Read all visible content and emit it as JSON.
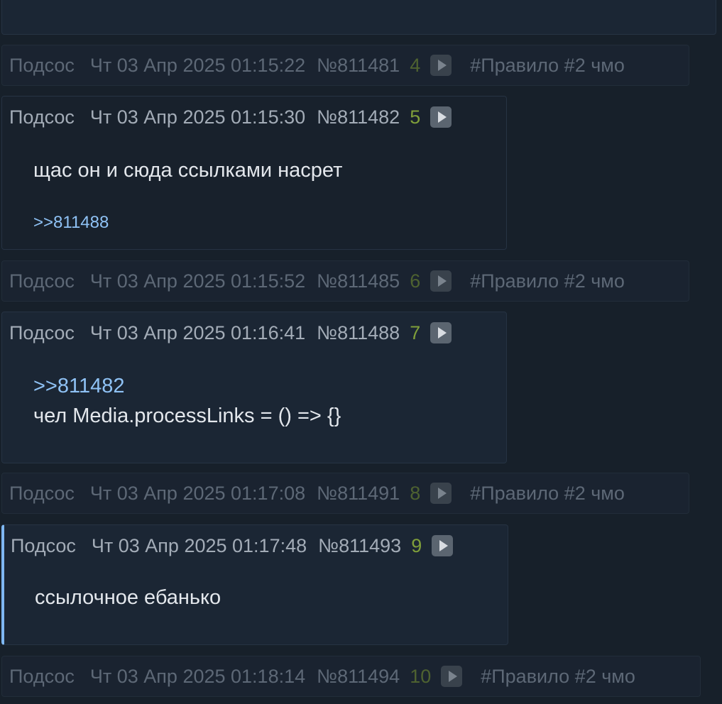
{
  "posts": [
    {
      "name": "Подсос",
      "date": "Чт 03 Апр 2025 01:15:22",
      "num": "№811481",
      "count": "4",
      "tag": "#Правило #2 чмо"
    },
    {
      "name": "Подсос",
      "date": "Чт 03 Апр 2025 01:15:30",
      "num": "№811482",
      "count": "5",
      "text": "щас он и сюда ссылками насрет",
      "reply": ">>811488"
    },
    {
      "name": "Подсос",
      "date": "Чт 03 Апр 2025 01:15:52",
      "num": "№811485",
      "count": "6",
      "tag": "#Правило #2 чмо"
    },
    {
      "name": "Подсос",
      "date": "Чт 03 Апр 2025 01:16:41",
      "num": "№811488",
      "count": "7",
      "quote": ">>811482",
      "text": "чел Media.processLinks = () => {}"
    },
    {
      "name": "Подсос",
      "date": "Чт 03 Апр 2025 01:17:08",
      "num": "№811491",
      "count": "8",
      "tag": "#Правило #2 чмо"
    },
    {
      "name": "Подсос",
      "date": "Чт 03 Апр 2025 01:17:48",
      "num": "№811493",
      "count": "9",
      "text": "ссылочное ебанько"
    },
    {
      "name": "Подсос",
      "date": "Чт 03 Апр 2025 01:18:14",
      "num": "№811494",
      "count": "10",
      "tag": "#Правило #2 чмо"
    }
  ]
}
